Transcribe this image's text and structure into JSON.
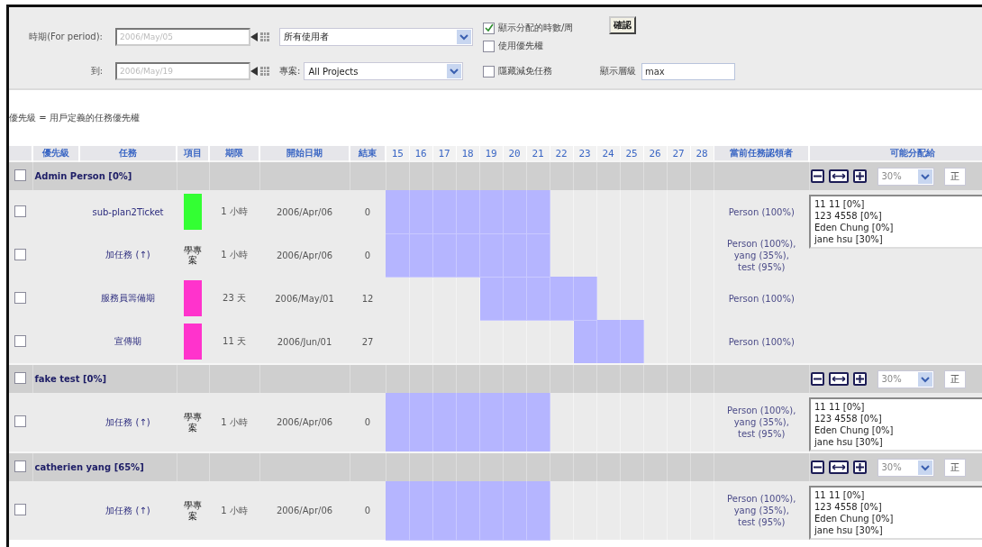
{
  "filters": {
    "period_label": "時期(For period):",
    "from_date": "2006/May/05",
    "user_select": "所有使用者",
    "to_label": "到:",
    "to_date": "2006/May/19",
    "project_label": "專案:",
    "project_select": "All Projects",
    "checkboxes": [
      {
        "label": "顯示分配的時數/周",
        "checked": true
      },
      {
        "label": "使用優先權",
        "checked": false
      },
      {
        "label": "隱藏減免任務",
        "checked": false
      }
    ],
    "confirm_button": "確認",
    "level_label": "顯示層級",
    "level_value": "max"
  },
  "note": "優先級 = 用戶定義的任務優先權",
  "table": {
    "columns": [
      "優先級",
      "任務",
      "項目",
      "期限",
      "開始日期",
      "結束"
    ],
    "days": [
      "15",
      "16",
      "17",
      "18",
      "19",
      "20",
      "21",
      "22",
      "23",
      "24",
      "25",
      "26",
      "27",
      "28"
    ],
    "columns_after": [
      "當前任務認領者",
      "可能分配給"
    ]
  },
  "groups": [
    {
      "name": "Admin Person [0%]",
      "checked": false,
      "assign_percent": "30%",
      "assign_mode": "正",
      "assign_options": [
        "11 11 [0%]",
        "123 4558 [0%]",
        "Eden Chung [0%]",
        "jane hsu [30%]"
      ],
      "tasks": [
        {
          "name": "sub-plan2Ticket",
          "checked": false,
          "project": {
            "kind": "color",
            "color": "#33ff33"
          },
          "duration": "1 小時",
          "start": "2006/Apr/06",
          "end": "0",
          "filled": [
            true,
            true,
            true,
            true,
            true,
            true,
            true,
            false,
            false,
            false,
            false,
            false,
            false,
            false
          ],
          "claimants": [
            "Person (100%)"
          ]
        },
        {
          "name": "加任務 (↑)",
          "checked": false,
          "project": {
            "kind": "text",
            "label": "學專案"
          },
          "duration": "1 小時",
          "start": "2006/Apr/06",
          "end": "0",
          "filled": [
            true,
            true,
            true,
            true,
            true,
            true,
            true,
            false,
            false,
            false,
            false,
            false,
            false,
            false
          ],
          "claimants": [
            "Person (100%),",
            "yang (35%),",
            "test (95%)"
          ]
        },
        {
          "name": "服務員籌備期",
          "checked": false,
          "project": {
            "kind": "color",
            "color": "#ff33cc"
          },
          "duration": "23 天",
          "start": "2006/May/01",
          "end": "12",
          "filled": [
            false,
            false,
            false,
            false,
            true,
            true,
            true,
            true,
            true,
            false,
            false,
            false,
            false,
            false
          ],
          "claimants": [
            "Person (100%)"
          ]
        },
        {
          "name": "宣傳期",
          "checked": false,
          "project": {
            "kind": "color",
            "color": "#ff33cc"
          },
          "duration": "11 天",
          "start": "2006/Jun/01",
          "end": "27",
          "filled": [
            false,
            false,
            false,
            false,
            false,
            false,
            false,
            false,
            true,
            true,
            true,
            false,
            false,
            false
          ],
          "claimants": [
            "Person (100%)"
          ]
        }
      ]
    },
    {
      "name": "fake test [0%]",
      "checked": false,
      "assign_percent": "30%",
      "assign_mode": "正",
      "assign_options": [
        "11 11 [0%]",
        "123 4558 [0%]",
        "Eden Chung [0%]",
        "jane hsu [30%]"
      ],
      "tasks": [
        {
          "name": "加任務 (↑)",
          "checked": false,
          "project": {
            "kind": "text",
            "label": "學專案"
          },
          "duration": "1 小時",
          "start": "2006/Apr/06",
          "end": "0",
          "filled": [
            true,
            true,
            true,
            true,
            true,
            true,
            true,
            false,
            false,
            false,
            false,
            false,
            false,
            false
          ],
          "claimants": [
            "Person (100%),",
            "yang (35%),",
            "test (95%)"
          ]
        }
      ]
    },
    {
      "name": "catherien yang [65%]",
      "checked": false,
      "assign_percent": "30%",
      "assign_mode": "正",
      "assign_options": [
        "11 11 [0%]",
        "123 4558 [0%]",
        "Eden Chung [0%]",
        "jane hsu [30%]"
      ],
      "tasks": [
        {
          "name": "加任務 (↑)",
          "checked": false,
          "project": {
            "kind": "text",
            "label": "學專案"
          },
          "duration": "1 小時",
          "start": "2006/Apr/06",
          "end": "0",
          "filled": [
            true,
            true,
            true,
            true,
            true,
            true,
            true,
            false,
            false,
            false,
            false,
            false,
            false,
            false
          ],
          "claimants": [
            "Person (100%),",
            "yang (35%),",
            "test (95%)"
          ]
        }
      ]
    }
  ]
}
